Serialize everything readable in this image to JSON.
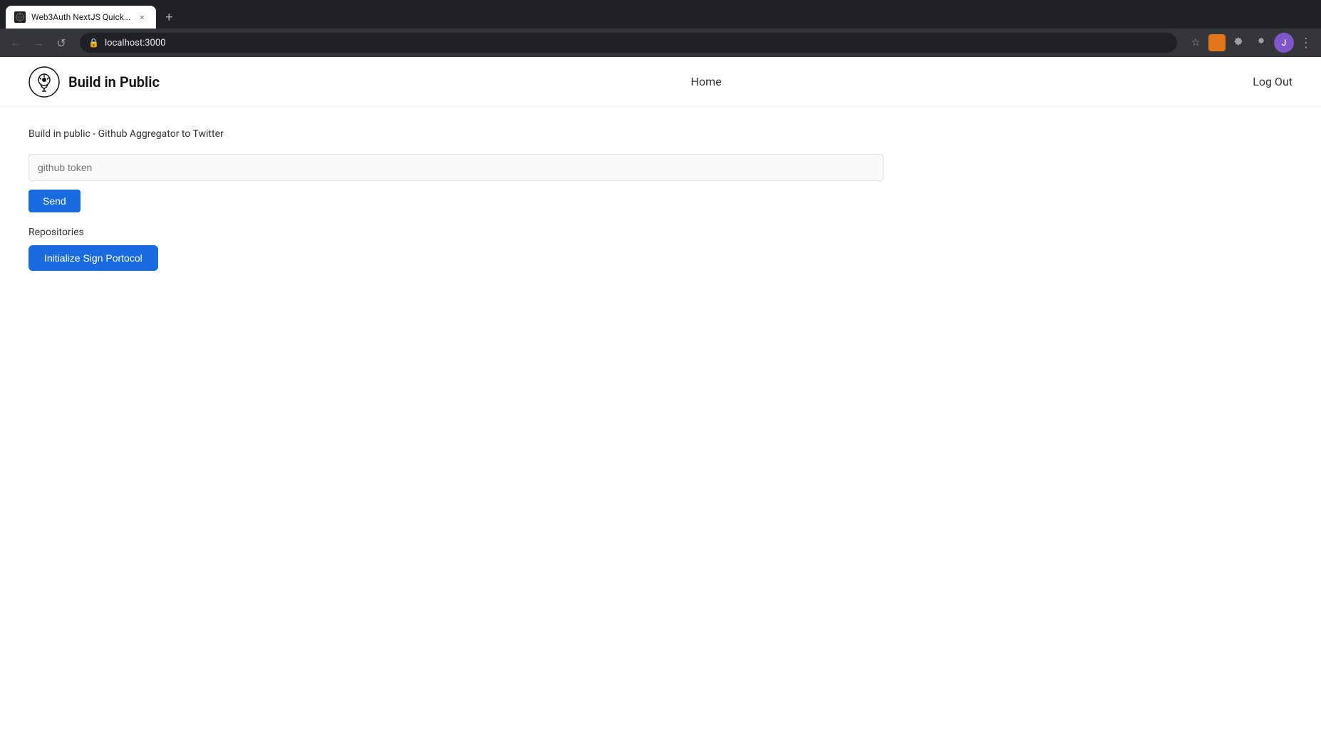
{
  "browser": {
    "tab": {
      "favicon": "globe",
      "title": "Web3Auth NextJS Quick...",
      "close_label": "×"
    },
    "new_tab_label": "+",
    "toolbar": {
      "back_label": "←",
      "forward_label": "→",
      "reload_label": "↺",
      "address": "localhost:3000",
      "bookmark_label": "☆",
      "profile_label": "J",
      "more_label": "⋮"
    }
  },
  "app": {
    "brand": {
      "name": "Build in Public",
      "logo_alt": "lightbulb logo"
    },
    "nav": {
      "home_label": "Home",
      "logout_label": "Log Out"
    },
    "main": {
      "subtitle": "Build in public - Github Aggregator to Twitter",
      "github_token_placeholder": "github token",
      "send_button_label": "Send",
      "repositories_label": "Repositories",
      "init_sign_button_label": "Initialize Sign Portocol"
    }
  }
}
